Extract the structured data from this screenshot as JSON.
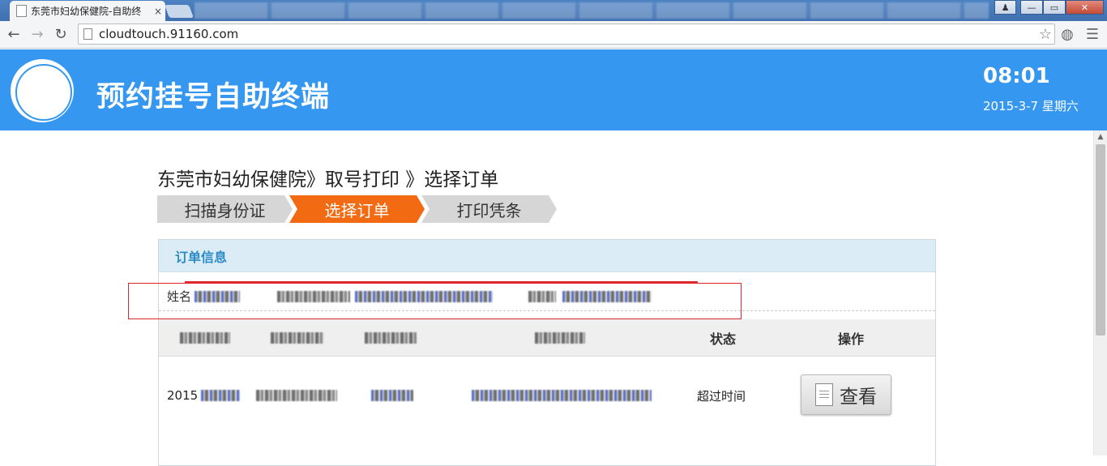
{
  "browser": {
    "tab_title": "东莞市妇幼保健院-自助终",
    "tab_close": "×",
    "url": "cloudtouch.91160.com",
    "back": "←",
    "forward": "→",
    "reload": "↻",
    "star": "☆",
    "minimize": "—",
    "maximize": "▭",
    "close": "✕"
  },
  "header": {
    "title": "预约挂号自助终端",
    "time": "08:01",
    "date": "2015-3-7 星期六"
  },
  "breadcrumb": "东莞市妇幼保健院》取号打印 》选择订单",
  "steps": [
    {
      "label": "扫描身份证",
      "active": false
    },
    {
      "label": "选择订单",
      "active": true
    },
    {
      "label": "打印凭条",
      "active": false
    }
  ],
  "panel": {
    "title": "订单信息",
    "name_label": "姓名",
    "columns": {
      "status": "状态",
      "action": "操作"
    },
    "row": {
      "date_prefix": "2015",
      "status": "超过时间",
      "view_label": "查看"
    }
  },
  "colors": {
    "header_bg": "#3597f0",
    "step_active": "#f26a12",
    "panel_head_bg": "#dcecf7",
    "highlight_red": "#e0262b"
  }
}
